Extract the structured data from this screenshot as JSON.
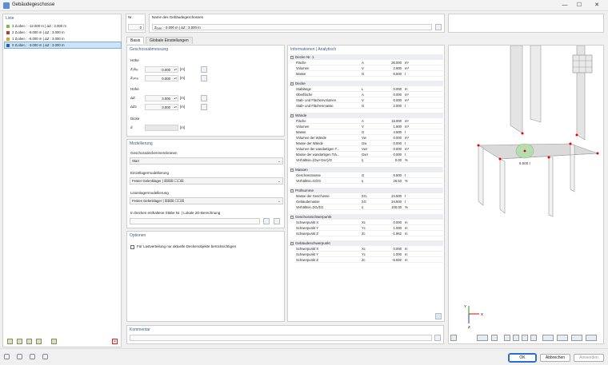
{
  "window": {
    "title": "Gebäudegeschosse",
    "minimize": "—",
    "maximize": "☐",
    "close": "✕"
  },
  "list": {
    "header": "Liste",
    "items": [
      {
        "no": "3",
        "label": "Z₍ober₎ : -12.000 m | ΔZ : 3.000 m",
        "color": "#7cbf3c"
      },
      {
        "no": "2",
        "label": "Z₍ober₎ : -9.000 m | ΔZ : 3.000 m",
        "color": "#c0392b"
      },
      {
        "no": "1",
        "label": "Z₍ober₎ : -6.000 m | ΔZ : 3.000 m",
        "color": "#e0a21a"
      },
      {
        "no": "0",
        "label": "Z₍ober₎ : -3.000 m | ΔZ : 3.000 m",
        "color": "#2a5fb0"
      }
    ],
    "delete_icon": "✕"
  },
  "header": {
    "nr_label": "Nr.",
    "nr_value": "0",
    "name_label": "Name des Gebäudegeschosses",
    "name_value": "Zₒₑₑₑ : -3.000 m | ΔZ : 3.000 m"
  },
  "tabs": [
    "Basis",
    "Globale Einstellungen"
  ],
  "geometry": {
    "header": "Geschossabmessung",
    "hoehe_label": "Höhe",
    "zober_label": "Zₒbₑᵣ",
    "zober_value": "-3.000",
    "zober_unit": "[m]",
    "zunter_label": "Zᵤₙₜₑᵣ",
    "zunter_value": "0.000",
    "zunter_unit": "[m]",
    "hoehe2_label": "Höhe",
    "dz_label": "ΔZ",
    "dz_value": "3.000",
    "dz_unit": "[m]",
    "dzc_label": "ΔZc",
    "dzc_value": "3.000",
    "dzc_unit": "[m]",
    "dicke_label": "Dicke",
    "d_label": "d",
    "d_unit": "[m]"
  },
  "modeling": {
    "header": "Modellierung",
    "slab_label": "Geschossdeckenmembranen",
    "slab_value": "Starr",
    "support_label": "Einzellagermodellierung",
    "support_value": "Fester Gelenklager | ☒☒☒ ☐☐☒",
    "line_label": "Linienlagermodellierung",
    "line_value": "Festes Gelenklager | ☒☒☒ ☐☐☒",
    "members_label": "In Decken enthaltene Stäbe Nr. | Lokale 2D-Berechnung"
  },
  "options": {
    "header": "Optionen",
    "checkbox_label": "Für Lastverteilung nur aktuelle Deckenobjekte berücksichtigen"
  },
  "comment": {
    "label": "Kommentar"
  },
  "info": {
    "header": "Informationen | Analytisch",
    "groups": [
      {
        "title": "Decke Nr. 1",
        "rows": [
          {
            "n": "Fläche",
            "s": "A",
            "v": "26.000",
            "u": "m²"
          },
          {
            "n": "Volumen",
            "s": "V",
            "v": "2.600",
            "u": "m³"
          },
          {
            "n": "Masse",
            "s": "G",
            "v": "6.500",
            "u": "t"
          }
        ]
      },
      {
        "title": "Decke",
        "rows": [
          {
            "n": "Stablänge",
            "s": "L",
            "v": "0.000",
            "u": "m"
          },
          {
            "n": "Oberfläche",
            "s": "A",
            "v": "0.000",
            "u": "m²"
          },
          {
            "n": "Stab- und Flächenvolumen",
            "s": "V",
            "v": "0.000",
            "u": "m³"
          },
          {
            "n": "Stab- und Flächenmasse",
            "s": "G",
            "v": "2.000",
            "u": "t"
          }
        ]
      },
      {
        "title": "Wände",
        "rows": [
          {
            "n": "Fläche",
            "s": "A",
            "v": "18.000",
            "u": "m²"
          },
          {
            "n": "Volumen",
            "s": "V",
            "v": "1.800",
            "u": "m³"
          },
          {
            "n": "Masse",
            "s": "G",
            "v": "4.500",
            "u": "t"
          },
          {
            "n": "Volumen der Wände",
            "s": "Vᴡ",
            "v": "0.000",
            "u": "m³"
          },
          {
            "n": "Masse der Wände",
            "s": "Gᴡ",
            "v": "0.000",
            "u": "t"
          },
          {
            "n": "Volumen der wandartigen T...",
            "s": "Vᴡᴛ",
            "v": "0.000",
            "u": "m³"
          },
          {
            "n": "Masse der wandartigen Trä...",
            "s": "Gᴡᴛ",
            "v": "0.000",
            "u": "t"
          },
          {
            "n": "Verhältnis=(Gᴡ+Gᴡᴛ)/G",
            "s": "η",
            "v": "0.00",
            "u": "%"
          }
        ]
      },
      {
        "title": "Massen",
        "rows": [
          {
            "n": "Geschossmasse",
            "s": "G",
            "v": "6.500",
            "u": "t"
          },
          {
            "n": "Verhältnis=G/ΣG",
            "s": "η",
            "v": "26.53",
            "u": "%"
          }
        ]
      },
      {
        "title": "Prüfsumme",
        "rows": [
          {
            "n": "Masse der Geschosse",
            "s": "ΣGᵢ",
            "v": "24.500",
            "u": "t"
          },
          {
            "n": "Gebäudemasse",
            "s": "ΣG",
            "v": "24.500",
            "u": "t"
          },
          {
            "n": "Verhältnis=ΣGᵢ/ΣG",
            "s": "η",
            "v": "100.00",
            "u": "%"
          }
        ]
      },
      {
        "title": "Geschossschwerpunkt",
        "rows": [
          {
            "n": "Schwerpunkt X",
            "s": "Xc",
            "v": "0.000",
            "u": "m"
          },
          {
            "n": "Schwerpunkt Y",
            "s": "Yc",
            "v": "1.000",
            "u": "m"
          },
          {
            "n": "Schwerpunkt Z",
            "s": "Zc",
            "v": "-1.962",
            "u": "m"
          }
        ]
      },
      {
        "title": "Gebäudeschwerpunkt",
        "rows": [
          {
            "n": "Schwerpunkt X",
            "s": "Xc",
            "v": "0.000",
            "u": "m"
          },
          {
            "n": "Schwerpunkt Y",
            "s": "Yc",
            "v": "1.000",
            "u": "m"
          },
          {
            "n": "Schwerpunkt Z",
            "s": "Zc",
            "v": "-6.592",
            "u": "m"
          }
        ]
      }
    ]
  },
  "view": {
    "label_center": "6.500 t",
    "axis_x": "X",
    "axis_y": "Y",
    "axis_z": "Z"
  },
  "footer": {
    "ok": "OK",
    "cancel": "Abbrechen",
    "apply": "Anwenden"
  }
}
